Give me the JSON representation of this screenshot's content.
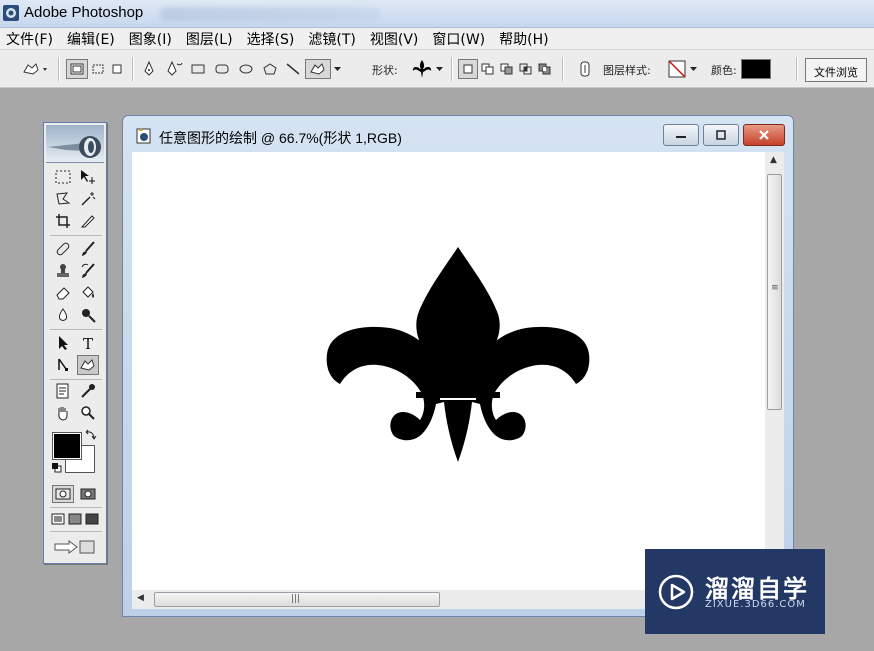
{
  "app": {
    "title": "Adobe Photoshop"
  },
  "menu": [
    {
      "label": "文件(F)"
    },
    {
      "label": "编辑(E)"
    },
    {
      "label": "图象(I)"
    },
    {
      "label": "图层(L)"
    },
    {
      "label": "选择(S)"
    },
    {
      "label": "滤镜(T)"
    },
    {
      "label": "视图(V)"
    },
    {
      "label": "窗口(W)"
    },
    {
      "label": "帮助(H)"
    }
  ],
  "options": {
    "shape_label": "形状:",
    "layer_style_label": "图层样式:",
    "color_label": "颜色:",
    "color_value": "#000000",
    "file_browser_label": "文件浏览"
  },
  "toolbox": {
    "foreground_color": "#000000",
    "background_color": "#ffffff"
  },
  "document": {
    "title": "任意图形的绘制 @ 66.7%(形状 1,RGB)",
    "shape_icon": "fleur-de-lis-icon"
  },
  "watermark": {
    "brand": "溜溜自学",
    "url": "ZIXUE.3D66.COM"
  }
}
